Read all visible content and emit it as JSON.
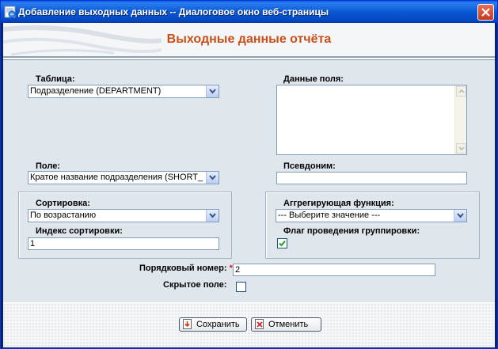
{
  "window": {
    "title": "Добавление выходных данных -- Диалоговое окно веб-страницы"
  },
  "page": {
    "title": "Выходные данные отчёта"
  },
  "form": {
    "table_label": "Таблица:",
    "table_value": "Подразделение (DEPARTMENT)",
    "field_data_label": "Данные поля:",
    "field_label": "Поле:",
    "field_value": "Кратое название подразделения (SHORT_",
    "alias_label": "Псевдоним:",
    "alias_value": "",
    "sort_label": "Сортировка:",
    "sort_value": "По возрастанию",
    "sort_index_label": "Индекс сортировки:",
    "sort_index_value": "1",
    "aggregate_label": "Аггрегирующая функция:",
    "aggregate_value": "--- Выберите значение ---",
    "group_flag_label": "Флаг проведения группировки:",
    "group_flag_checked": true,
    "order_number_label": "Порядковый номер:",
    "required_mark": "*",
    "order_number_value": "2",
    "hidden_field_label": "Скрытое поле:",
    "hidden_field_checked": false
  },
  "buttons": {
    "save_label": "Сохранить",
    "cancel_label": "Отменить"
  },
  "icons": {
    "window": "ie-page-icon",
    "close": "close-icon",
    "dropdown": "chevron-down-icon",
    "save": "save-icon",
    "cancel": "cancel-icon"
  },
  "colors": {
    "title_accent": "#c8501a",
    "form_background": "#dfe6ec",
    "titlebar": "#0a58d4"
  }
}
